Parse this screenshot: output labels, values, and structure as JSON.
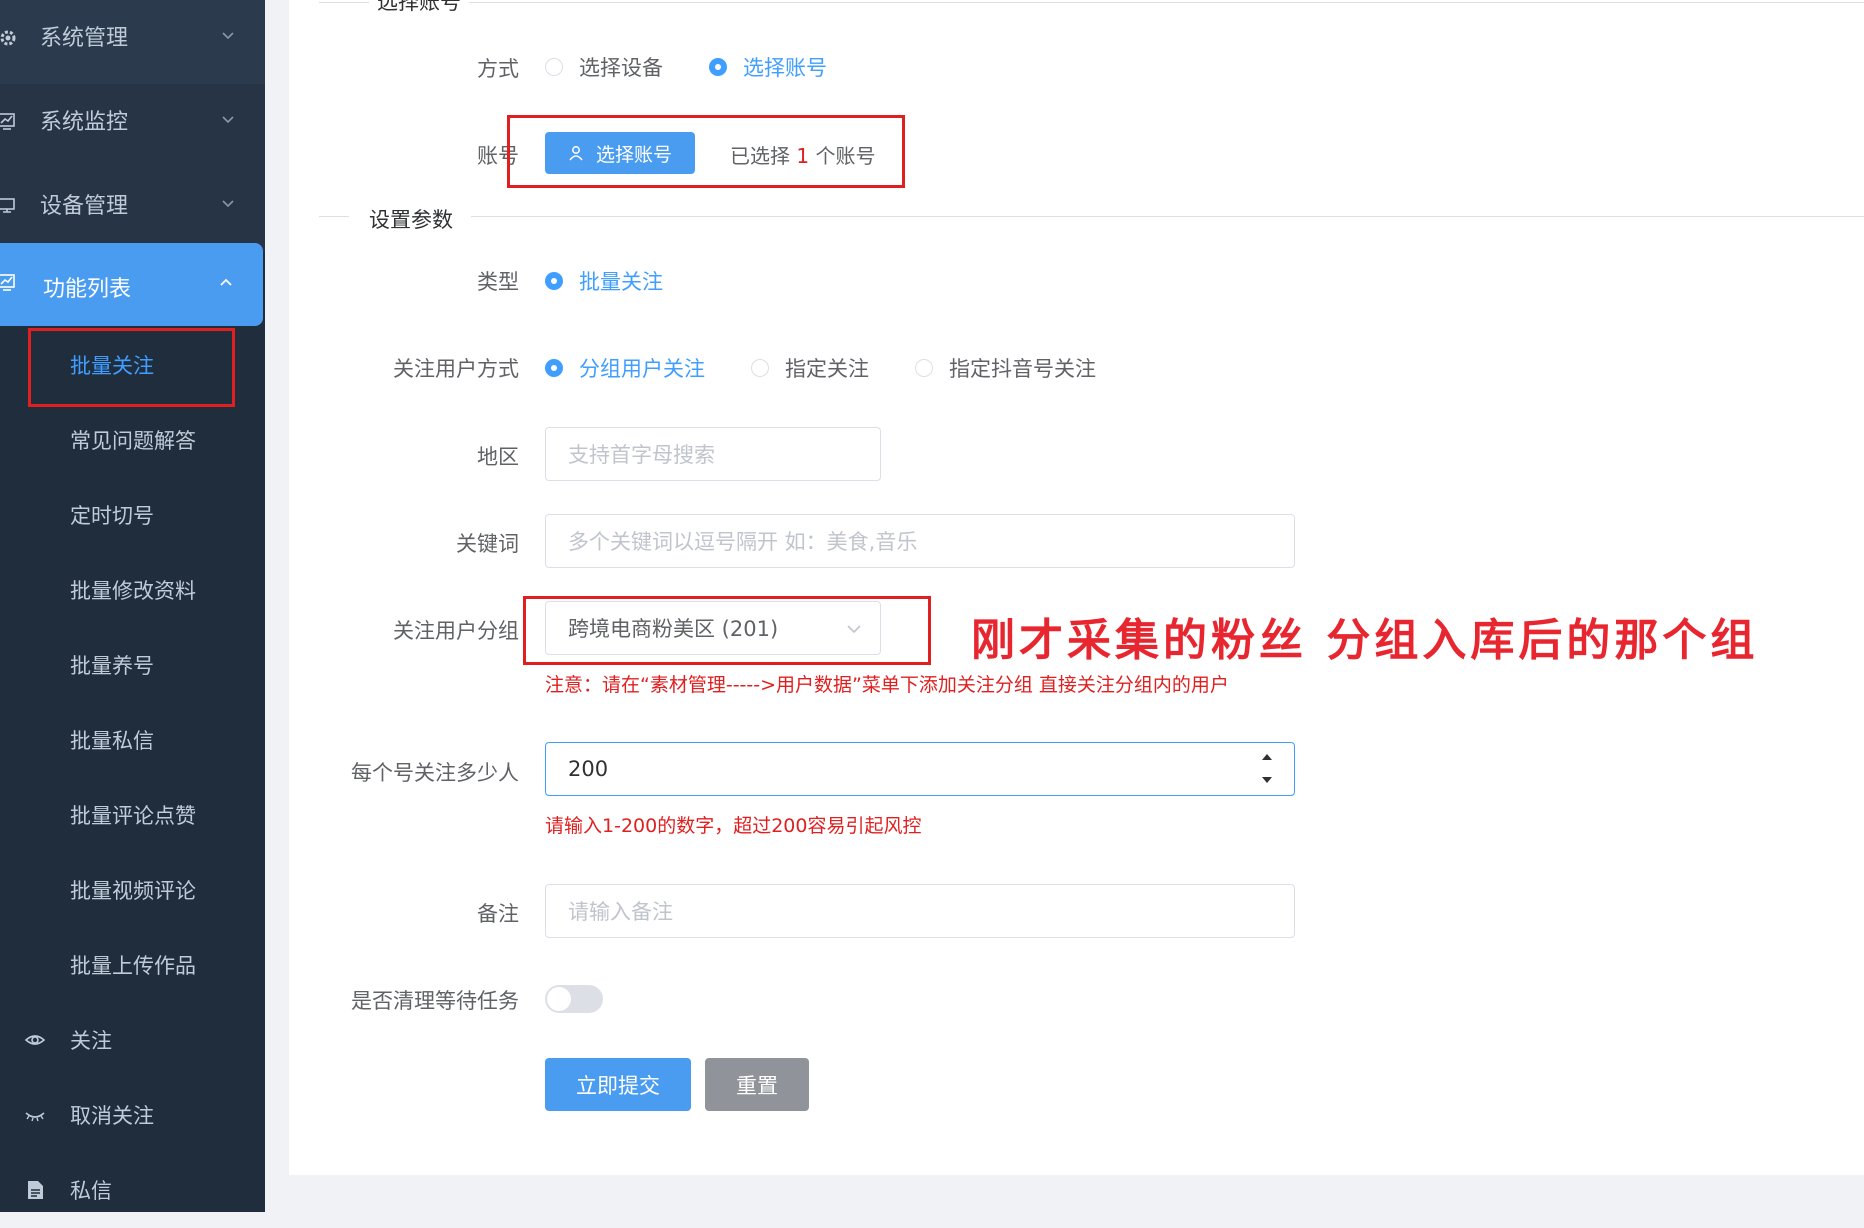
{
  "sidebar": {
    "menus": [
      {
        "label": "系统管理",
        "icon": "gear-icon"
      },
      {
        "label": "系统监控",
        "icon": "monitor-chart-icon"
      },
      {
        "label": "设备管理",
        "icon": "device-icon"
      }
    ],
    "active_menu": {
      "label": "功能列表",
      "icon": "chart-icon"
    },
    "sub_items": [
      {
        "label": "批量关注"
      },
      {
        "label": "常见问题解答"
      },
      {
        "label": "定时切号"
      },
      {
        "label": "批量修改资料"
      },
      {
        "label": "批量养号"
      },
      {
        "label": "批量私信"
      },
      {
        "label": "批量评论点赞"
      },
      {
        "label": "批量视频评论"
      },
      {
        "label": "批量上传作品"
      }
    ],
    "bottom_items": [
      {
        "label": "关注",
        "icon": "eye-icon"
      },
      {
        "label": "取消关注",
        "icon": "eye-closed-icon"
      },
      {
        "label": "私信",
        "icon": "document-icon"
      }
    ]
  },
  "form": {
    "section1_title": "选择账号",
    "mode_label": "方式",
    "mode_options": [
      "选择设备",
      "选择账号"
    ],
    "account_label": "账号",
    "select_account_button": "选择账号",
    "selected_prefix": "已选择",
    "selected_count": "1",
    "selected_suffix": "个账号",
    "section2_title": "设置参数",
    "type_label": "类型",
    "type_option": "批量关注",
    "follow_mode_label": "关注用户方式",
    "follow_mode_options": [
      "分组用户关注",
      "指定关注",
      "指定抖音号关注"
    ],
    "region_label": "地区",
    "region_placeholder": "支持首字母搜索",
    "keyword_label": "关键词",
    "keyword_placeholder": "多个关键词以逗号隔开 如：美食,音乐",
    "group_label": "关注用户分组",
    "group_value": "跨境电商粉美区 (201)",
    "group_note": "注意：请在“素材管理----->用户数据”菜单下添加关注分组 直接关注分组内的用户",
    "annotation": "刚才采集的粉丝 分组入库后的那个组",
    "count_label": "每个号关注多少人",
    "count_value": "200",
    "count_hint": "请输入1-200的数字，超过200容易引起风控",
    "remark_label": "备注",
    "remark_placeholder": "请输入备注",
    "clear_label": "是否清理等待任务",
    "submit_button": "立即提交",
    "reset_button": "重置"
  }
}
